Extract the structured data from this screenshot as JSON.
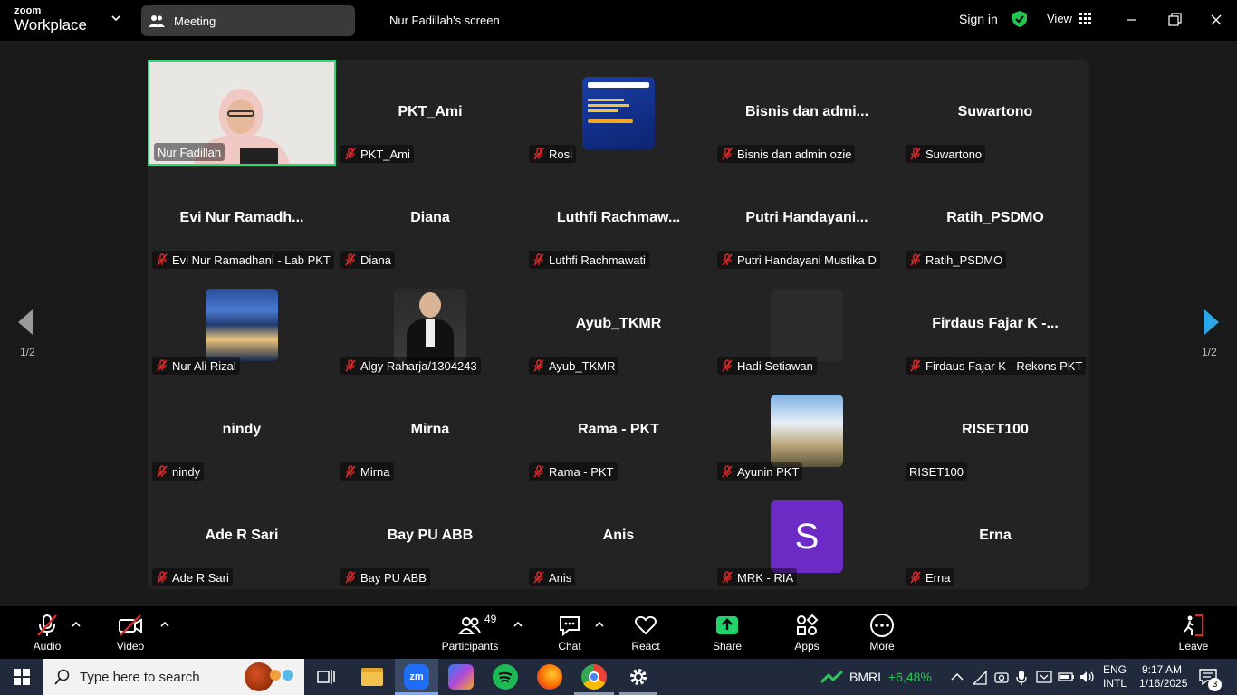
{
  "topbar": {
    "logo_line1": "zoom",
    "logo_line2": "Workplace",
    "meeting_tab": "Meeting",
    "screen_title": "Nur Fadillah's screen",
    "signin": "Sign in",
    "view": "View"
  },
  "grid": {
    "page_indicator": "1/2",
    "tiles": [
      {
        "display": "",
        "label": "Nur Fadillah",
        "muted": false,
        "kind": "video"
      },
      {
        "display": "PKT_Ami",
        "label": "PKT_Ami",
        "muted": true,
        "kind": "name"
      },
      {
        "display": "",
        "label": "Rosi",
        "muted": true,
        "kind": "poster"
      },
      {
        "display": "Bisnis dan admi...",
        "label": "Bisnis dan admin ozie",
        "muted": true,
        "kind": "name"
      },
      {
        "display": "Suwartono",
        "label": "Suwartono",
        "muted": true,
        "kind": "name"
      },
      {
        "display": "Evi Nur Ramadh...",
        "label": "Evi Nur Ramadhani - Lab PKT",
        "muted": true,
        "kind": "name"
      },
      {
        "display": "Diana",
        "label": "Diana",
        "muted": true,
        "kind": "name"
      },
      {
        "display": "Luthfi Rachmaw...",
        "label": "Luthfi Rachmawati",
        "muted": true,
        "kind": "name"
      },
      {
        "display": "Putri Handayani...",
        "label": "Putri Handayani Mustika D",
        "muted": true,
        "kind": "name"
      },
      {
        "display": "Ratih_PSDMO",
        "label": "Ratih_PSDMO",
        "muted": true,
        "kind": "name"
      },
      {
        "display": "",
        "label": "Nur Ali Rizal",
        "muted": true,
        "kind": "plant"
      },
      {
        "display": "",
        "label": "Algy Raharja/1304243",
        "muted": true,
        "kind": "person"
      },
      {
        "display": "Ayub_TKMR",
        "label": "Ayub_TKMR",
        "muted": true,
        "kind": "name"
      },
      {
        "display": "",
        "label": "Hadi Setiawan",
        "muted": true,
        "kind": "blank"
      },
      {
        "display": "Firdaus Fajar K -...",
        "label": "Firdaus Fajar K - Rekons PKT",
        "muted": true,
        "kind": "name"
      },
      {
        "display": "nindy",
        "label": "nindy",
        "muted": true,
        "kind": "name"
      },
      {
        "display": "Mirna",
        "label": "Mirna",
        "muted": true,
        "kind": "name"
      },
      {
        "display": "Rama - PKT",
        "label": "Rama - PKT",
        "muted": true,
        "kind": "name"
      },
      {
        "display": "",
        "label": "Ayunin PKT",
        "muted": true,
        "kind": "sky"
      },
      {
        "display": "RISET100",
        "label": "RISET100",
        "muted": false,
        "kind": "name"
      },
      {
        "display": "Ade R Sari",
        "label": "Ade R Sari",
        "muted": true,
        "kind": "name"
      },
      {
        "display": "Bay PU ABB",
        "label": "Bay PU ABB",
        "muted": true,
        "kind": "name"
      },
      {
        "display": "Anis",
        "label": "Anis",
        "muted": true,
        "kind": "name"
      },
      {
        "display": "S",
        "label": "MRK - RIA",
        "muted": true,
        "kind": "avatar"
      },
      {
        "display": "Erna",
        "label": "Erna",
        "muted": true,
        "kind": "name"
      }
    ]
  },
  "toolbar": {
    "audio": "Audio",
    "video": "Video",
    "participants": "Participants",
    "participants_count": "49",
    "chat": "Chat",
    "react": "React",
    "share": "Share",
    "apps": "Apps",
    "more": "More",
    "leave": "Leave"
  },
  "taskbar": {
    "search_placeholder": "Type here to search",
    "stock_name": "BMRI",
    "stock_change": "+6,48%",
    "lang1": "ENG",
    "lang2": "INTL",
    "time": "9:17 AM",
    "date": "1/16/2025",
    "notif_count": "3"
  },
  "colors": {
    "active_border": "#2fd87a",
    "share_green": "#22d36b",
    "avatar_purple": "#6b2bc4",
    "nav_blue": "#2aa7e8"
  }
}
